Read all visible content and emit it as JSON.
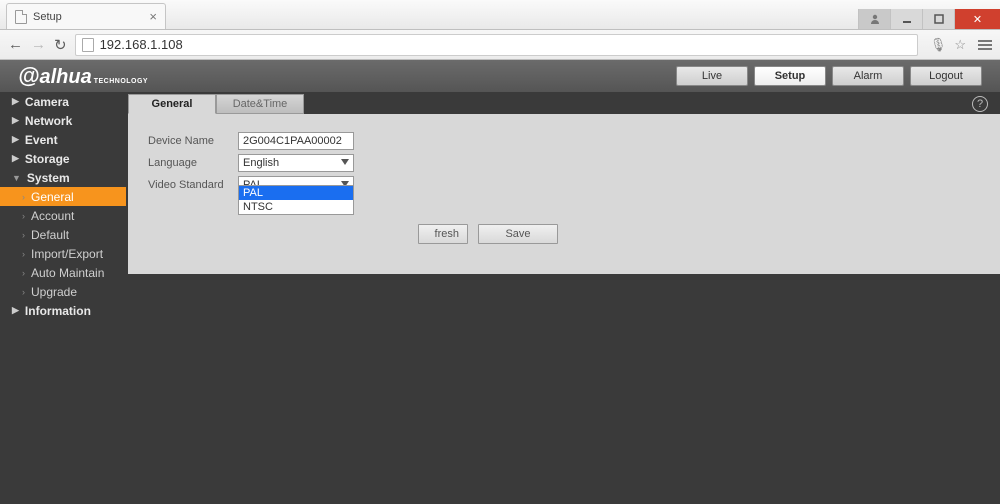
{
  "browser": {
    "tab_title": "Setup",
    "url": "192.168.1.108"
  },
  "logo": {
    "text": "alhua",
    "sub": "TECHNOLOGY"
  },
  "top_tabs": {
    "live": "Live",
    "setup": "Setup",
    "alarm": "Alarm",
    "logout": "Logout"
  },
  "sidebar": {
    "camera": "Camera",
    "network": "Network",
    "event": "Event",
    "storage": "Storage",
    "system": "System",
    "general": "General",
    "account": "Account",
    "default": "Default",
    "import_export": "Import/Export",
    "auto_maintain": "Auto Maintain",
    "upgrade": "Upgrade",
    "information": "Information"
  },
  "content_tabs": {
    "general": "General",
    "datetime": "Date&Time"
  },
  "form": {
    "device_name_label": "Device Name",
    "device_name_value": "2G004C1PAA00002",
    "language_label": "Language",
    "language_value": "English",
    "video_standard_label": "Video Standard",
    "video_standard_value": "PAL",
    "options": {
      "pal": "PAL",
      "ntsc": "NTSC"
    },
    "refresh_partial": "fresh",
    "save": "Save"
  }
}
